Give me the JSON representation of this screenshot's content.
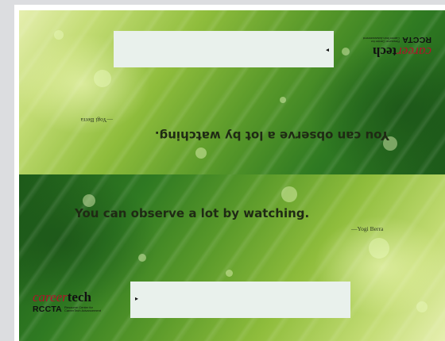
{
  "card": {
    "quote": "You can observe a lot by watching.",
    "attribution": "—Yogi Berra",
    "arrow_glyph": "▸"
  },
  "logo": {
    "career": "career",
    "tech": "tech",
    "acronym": "RCCTA",
    "description": "Resource Center for CareerTech Advancement"
  }
}
